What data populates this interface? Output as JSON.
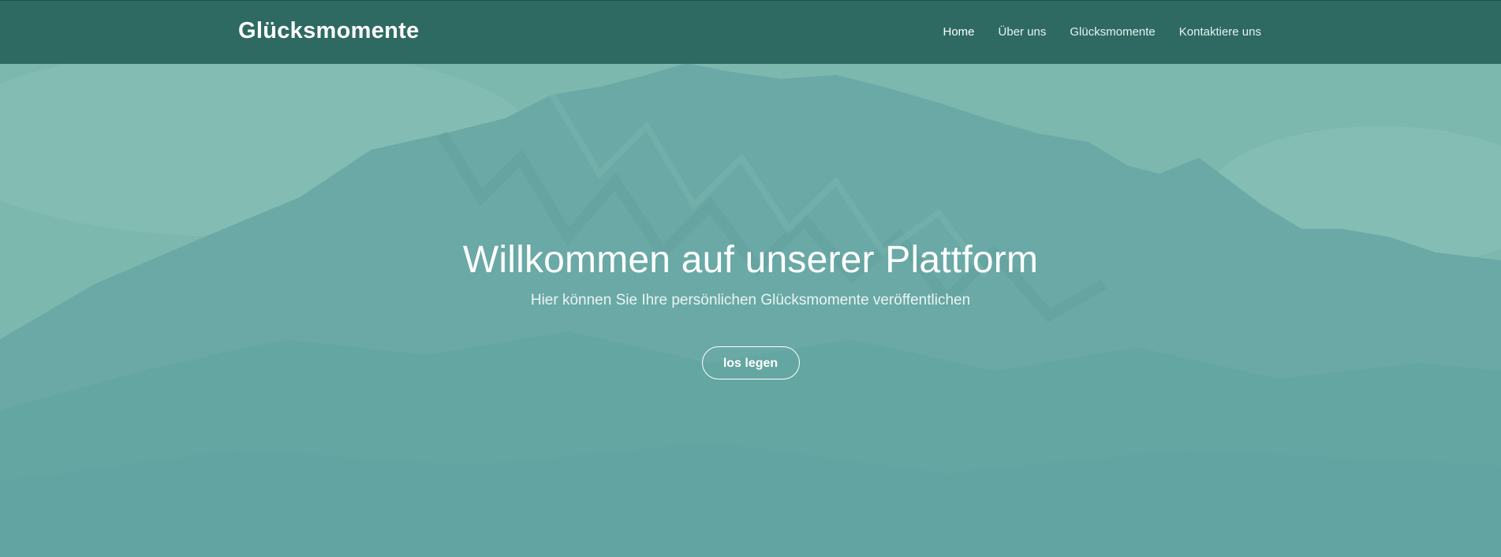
{
  "navbar": {
    "brand": "Glücksmomente",
    "links": [
      {
        "label": "Home",
        "active": true
      },
      {
        "label": "Über uns",
        "active": false
      },
      {
        "label": "Glücksmomente",
        "active": false
      },
      {
        "label": "Kontaktiere uns",
        "active": false
      }
    ]
  },
  "hero": {
    "title": "Willkommen auf unserer Plattform",
    "subtitle": "Hier können Sie Ihre persönlichen Glücksmomente veröffentlichen",
    "button_label": "los legen"
  },
  "colors": {
    "navbar_bg": "#2e6a62",
    "hero_overlay": "#6aa9a6",
    "text": "#ffffff"
  }
}
